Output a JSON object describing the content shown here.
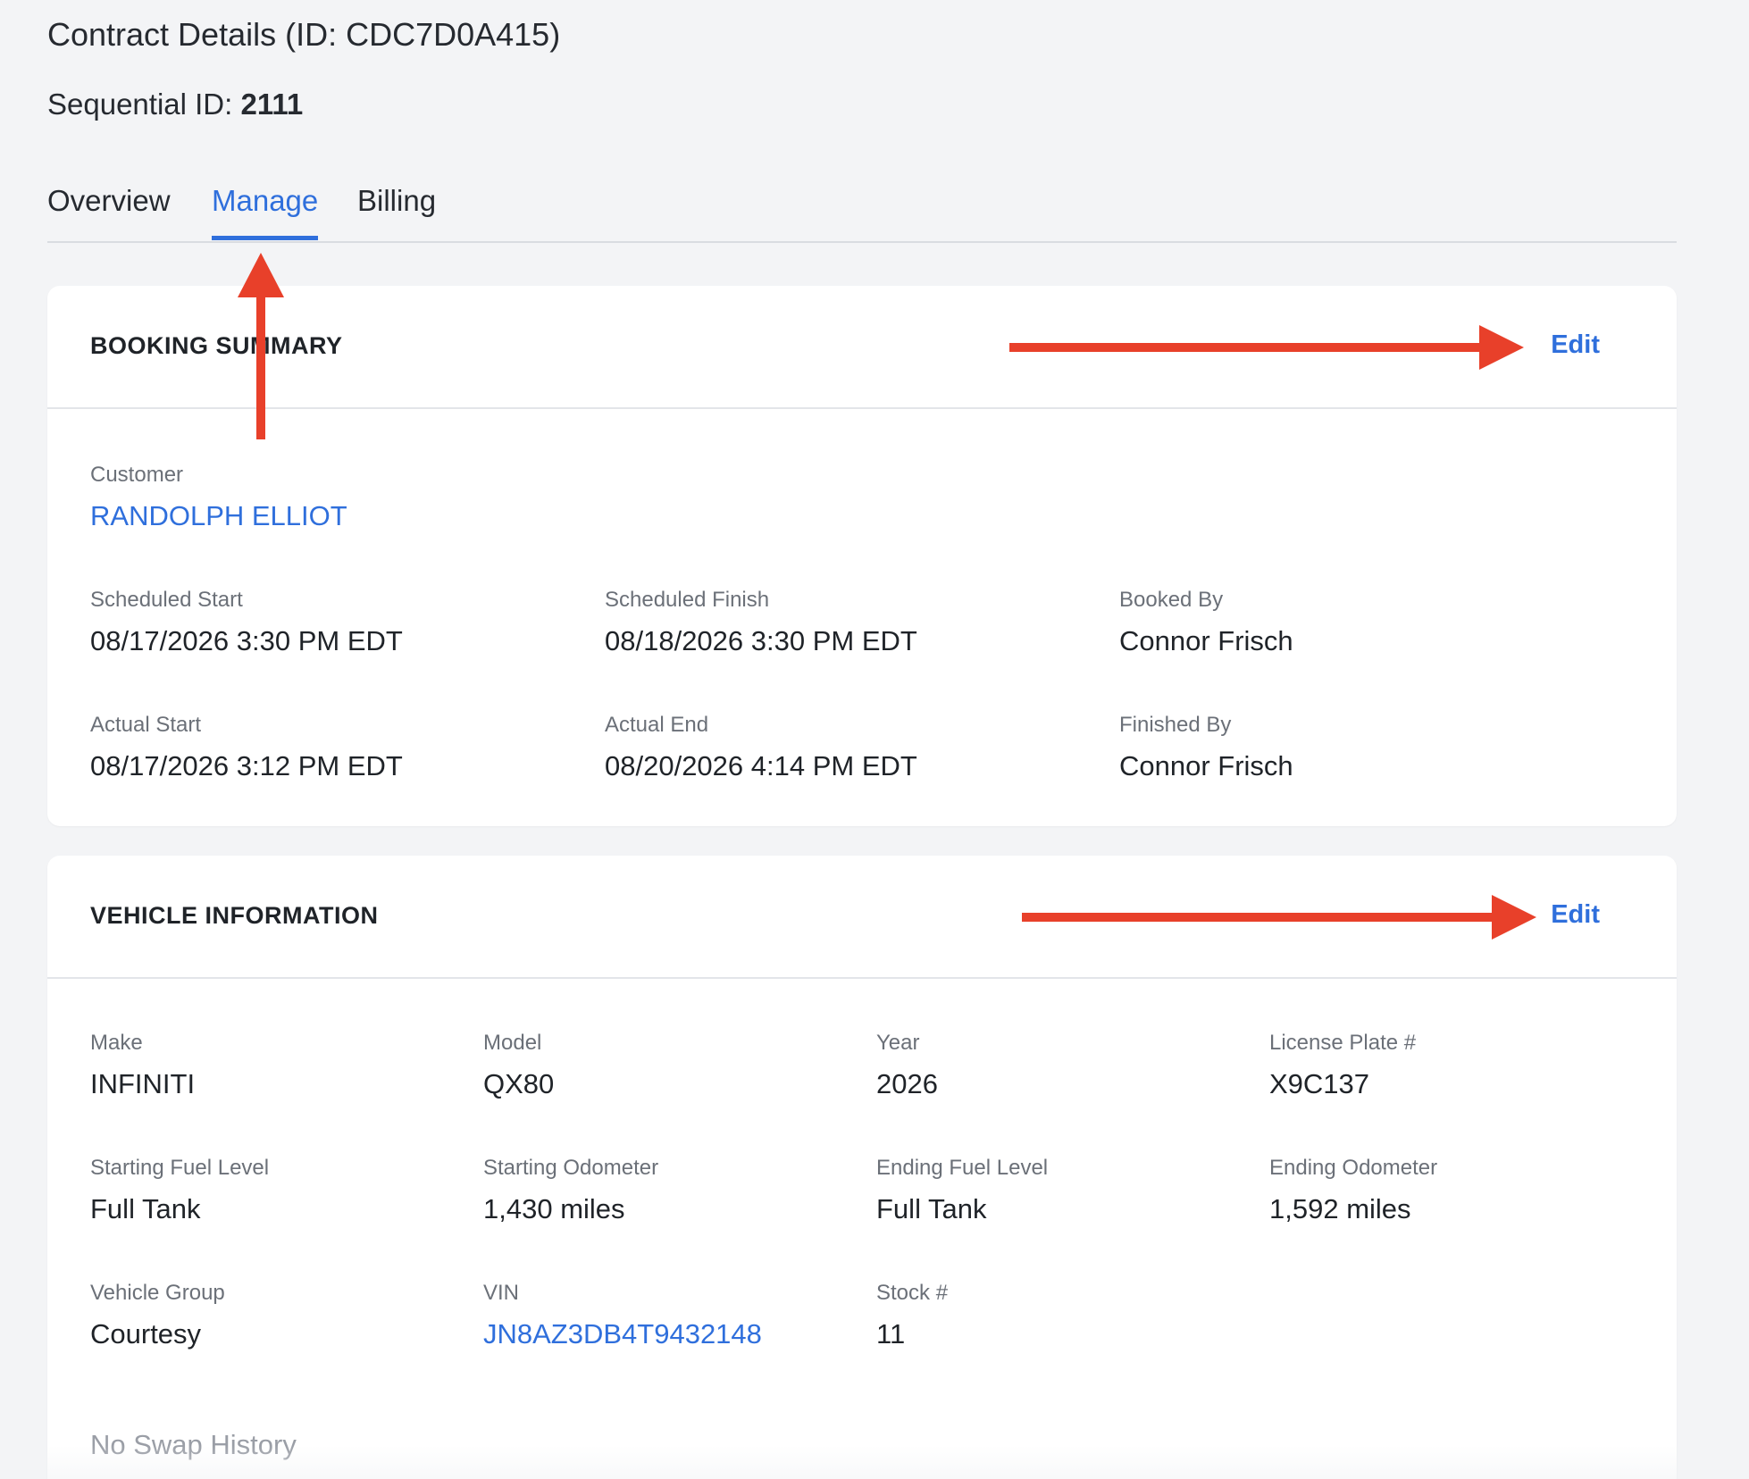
{
  "header": {
    "title": "Contract Details (ID: CDC7D0A415)",
    "sequential_label": "Sequential ID:",
    "sequential_value": "2111"
  },
  "tabs": [
    {
      "label": "Overview",
      "active": false
    },
    {
      "label": "Manage",
      "active": true
    },
    {
      "label": "Billing",
      "active": false
    }
  ],
  "booking_summary": {
    "title": "BOOKING SUMMARY",
    "edit_label": "Edit",
    "customer": {
      "label": "Customer",
      "value": "RANDOLPH ELLIOT"
    },
    "scheduled_start": {
      "label": "Scheduled Start",
      "value": "08/17/2026 3:30 PM EDT"
    },
    "scheduled_finish": {
      "label": "Scheduled Finish",
      "value": "08/18/2026 3:30 PM EDT"
    },
    "booked_by": {
      "label": "Booked By",
      "value": "Connor Frisch"
    },
    "actual_start": {
      "label": "Actual Start",
      "value": "08/17/2026 3:12 PM EDT"
    },
    "actual_end": {
      "label": "Actual End",
      "value": "08/20/2026 4:14 PM EDT"
    },
    "finished_by": {
      "label": "Finished By",
      "value": "Connor Frisch"
    }
  },
  "vehicle_information": {
    "title": "VEHICLE INFORMATION",
    "edit_label": "Edit",
    "make": {
      "label": "Make",
      "value": "INFINITI"
    },
    "model": {
      "label": "Model",
      "value": "QX80"
    },
    "year": {
      "label": "Year",
      "value": "2026"
    },
    "license_plate": {
      "label": "License Plate #",
      "value": "X9C137"
    },
    "starting_fuel": {
      "label": "Starting Fuel Level",
      "value": "Full Tank"
    },
    "starting_odometer": {
      "label": "Starting Odometer",
      "value": "1,430 miles"
    },
    "ending_fuel": {
      "label": "Ending Fuel Level",
      "value": "Full Tank"
    },
    "ending_odometer": {
      "label": "Ending Odometer",
      "value": "1,592 miles"
    },
    "vehicle_group": {
      "label": "Vehicle Group",
      "value": "Courtesy"
    },
    "vin": {
      "label": "VIN",
      "value": "JN8AZ3DB4T9432148"
    },
    "stock": {
      "label": "Stock #",
      "value": "11"
    },
    "swap_history": "No Swap History"
  },
  "colors": {
    "accent": "#2f6fdc",
    "annotation_arrow": "#e8402a",
    "background": "#f3f4f6"
  }
}
